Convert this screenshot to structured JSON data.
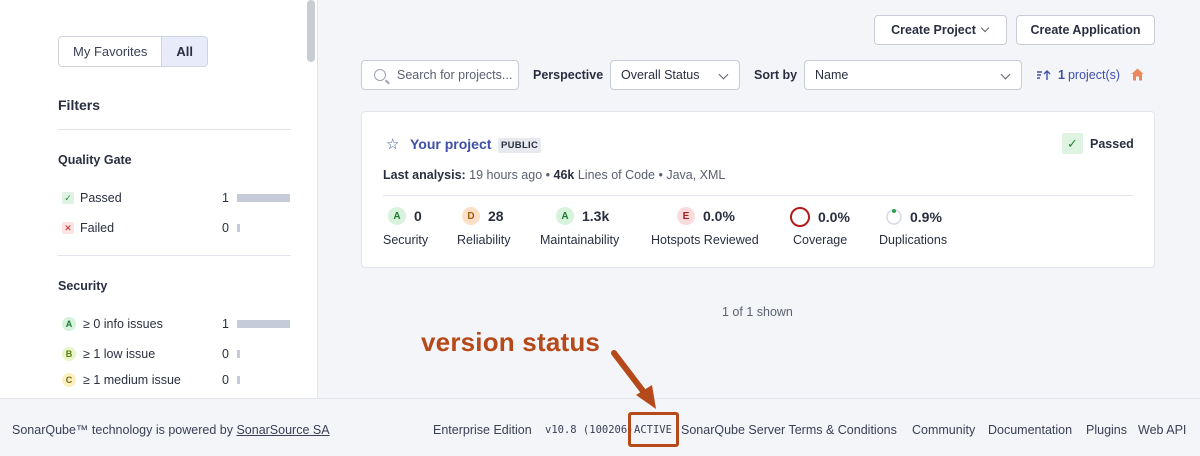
{
  "sidebar": {
    "toggle": {
      "favorites": "My Favorites",
      "all": "All"
    },
    "filters_title": "Filters",
    "quality_gate": {
      "title": "Quality Gate",
      "items": [
        {
          "label": "Passed",
          "count": "1",
          "fraction": 1.0
        },
        {
          "label": "Failed",
          "count": "0",
          "fraction": 0.0
        }
      ]
    },
    "security": {
      "title": "Security",
      "items": [
        {
          "rating": "A",
          "label": "≥ 0 info issues",
          "count": "1",
          "fraction": 1.0
        },
        {
          "rating": "B",
          "label": "≥ 1 low issue",
          "count": "0",
          "fraction": 0.0
        },
        {
          "rating": "C",
          "label": "≥ 1 medium issue",
          "count": "0",
          "fraction": 0.0
        }
      ]
    }
  },
  "header": {
    "create_project": "Create Project",
    "create_application": "Create Application",
    "search_placeholder": "Search for projects...",
    "perspective_label": "Perspective",
    "perspective_value": "Overall Status",
    "sort_label": "Sort by",
    "sort_value": "Name",
    "project_count": "1",
    "project_count_suffix": "project(s)"
  },
  "project": {
    "name": "Your project",
    "visibility": "PUBLIC",
    "quality_gate": "Passed",
    "last_analysis_label": "Last analysis:",
    "last_analysis_value": "19 hours ago",
    "loc_value": "46k",
    "loc_label": "Lines of Code",
    "languages": "Java, XML",
    "metrics": [
      {
        "rating": "A",
        "value": "0",
        "label": "Security"
      },
      {
        "rating": "D",
        "value": "28",
        "label": "Reliability"
      },
      {
        "rating": "A",
        "value": "1.3k",
        "label": "Maintainability"
      },
      {
        "rating": "E",
        "value": "0.0%",
        "label": "Hotspots Reviewed"
      },
      {
        "value": "0.0%",
        "label": "Coverage"
      },
      {
        "value": "0.9%",
        "label": "Duplications"
      }
    ]
  },
  "shown_text": "1 of 1 shown",
  "annotation": {
    "text": "version status"
  },
  "footer": {
    "powered_prefix": "SonarQube™ technology is powered by",
    "powered_link": "SonarSource SA",
    "edition": "Enterprise Edition",
    "version": "v10.8 (100206)",
    "status": "ACTIVE",
    "terms": "SonarQube Server Terms & Conditions",
    "community": "Community",
    "documentation": "Documentation",
    "plugins": "Plugins",
    "web_api": "Web API"
  },
  "colors": {
    "accent": "#3f50a8",
    "passed": "#1f8a3a",
    "annotation": "#b5491a",
    "coverage_ring": "#b31c1c"
  }
}
